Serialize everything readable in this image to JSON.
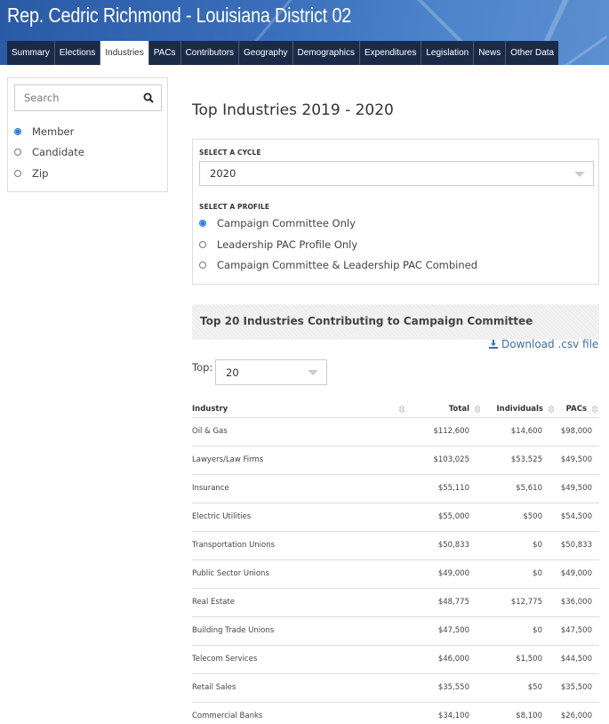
{
  "header": {
    "title": "Rep. Cedric Richmond - Louisiana District 02",
    "tabs": [
      {
        "label": "Summary",
        "active": false
      },
      {
        "label": "Elections",
        "active": false
      },
      {
        "label": "Industries",
        "active": true
      },
      {
        "label": "PACs",
        "active": false
      },
      {
        "label": "Contributors",
        "active": false
      },
      {
        "label": "Geography",
        "active": false
      },
      {
        "label": "Demographics",
        "active": false
      },
      {
        "label": "Expenditures",
        "active": false
      },
      {
        "label": "Legislation",
        "active": false
      },
      {
        "label": "News",
        "active": false
      },
      {
        "label": "Other Data",
        "active": false
      }
    ]
  },
  "sidebar": {
    "search_placeholder": "Search",
    "search_icon": "search-icon",
    "options": [
      {
        "label": "Member",
        "checked": true
      },
      {
        "label": "Candidate",
        "checked": false
      },
      {
        "label": "Zip",
        "checked": false
      }
    ]
  },
  "main": {
    "title": "Top Industries 2019 - 2020",
    "cycle_label": "SELECT A CYCLE",
    "cycle_value": "2020",
    "profile_label": "SELECT A PROFILE",
    "profiles": [
      {
        "label": "Campaign Committee Only",
        "checked": true
      },
      {
        "label": "Leadership PAC Profile Only",
        "checked": false
      },
      {
        "label": "Campaign Committee & Leadership PAC Combined",
        "checked": false
      }
    ],
    "section_title": "Top 20 Industries Contributing to Campaign Committee",
    "download_label": "Download .csv file",
    "download_icon": "download-icon",
    "top_label": "Top:",
    "top_value": "20",
    "table": {
      "columns": [
        "Industry",
        "Total",
        "Individuals",
        "PACs"
      ],
      "rows": [
        [
          "Oil & Gas",
          "$112,600",
          "$14,600",
          "$98,000"
        ],
        [
          "Lawyers/Law Firms",
          "$103,025",
          "$53,525",
          "$49,500"
        ],
        [
          "Insurance",
          "$55,110",
          "$5,610",
          "$49,500"
        ],
        [
          "Electric Utilities",
          "$55,000",
          "$500",
          "$54,500"
        ],
        [
          "Transportation Unions",
          "$50,833",
          "$0",
          "$50,833"
        ],
        [
          "Public Sector Unions",
          "$49,000",
          "$0",
          "$49,000"
        ],
        [
          "Real Estate",
          "$48,775",
          "$12,775",
          "$36,000"
        ],
        [
          "Building Trade Unions",
          "$47,500",
          "$0",
          "$47,500"
        ],
        [
          "Telecom Services",
          "$46,000",
          "$1,500",
          "$44,500"
        ],
        [
          "Retail Sales",
          "$35,550",
          "$50",
          "$35,500"
        ],
        [
          "Commercial Banks",
          "$34,100",
          "$8,100",
          "$26,000"
        ]
      ]
    }
  },
  "colors": {
    "header_blue": "#2a5aa6",
    "tab_bg": "#1b2a47",
    "accent": "#2a7ad8",
    "link": "#3a6fb0"
  }
}
